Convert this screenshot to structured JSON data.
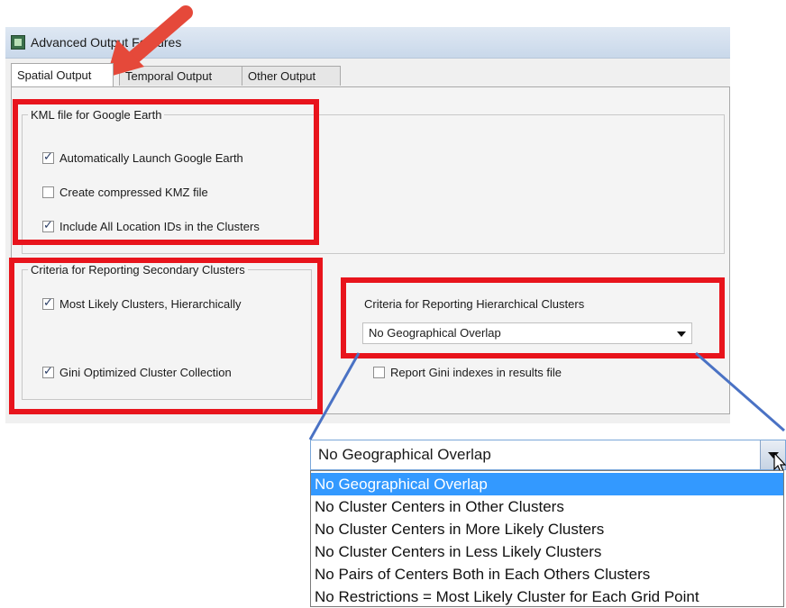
{
  "window": {
    "title": "Advanced Output Features",
    "icon": "app-icon"
  },
  "tabs": [
    "Spatial Output",
    "Temporal Output",
    "Other Output"
  ],
  "kml": {
    "legend": "KML file for Google Earth",
    "options": [
      {
        "label": "Automatically Launch Google Earth",
        "checked": true
      },
      {
        "label": "Create compressed KMZ file",
        "checked": false
      },
      {
        "label": "Include All Location IDs in the Clusters",
        "checked": true
      }
    ]
  },
  "secondary": {
    "legend": "Criteria for Reporting Secondary Clusters",
    "options": [
      {
        "label": "Most Likely Clusters, Hierarchically",
        "checked": true
      },
      {
        "label": "Gini Optimized Cluster Collection",
        "checked": true
      }
    ]
  },
  "hierarchical": {
    "label": "Criteria for Reporting Hierarchical Clusters",
    "selected": "No Geographical Overlap"
  },
  "gini_report": {
    "label": "Report Gini indexes in results file",
    "checked": false
  },
  "dropdown_zoom": {
    "selected": "No Geographical Overlap",
    "options": [
      "No Geographical Overlap",
      "No Cluster Centers in Other Clusters",
      "No Cluster Centers in More Likely Clusters",
      "No Cluster Centers in Less Likely Clusters",
      "No Pairs of Centers Both in Each Others Clusters",
      "No Restrictions = Most Likely Cluster for Each Grid Point"
    ]
  },
  "colors": {
    "highlight": "#e8141c",
    "callout_line": "#4a72c4",
    "arrow": "#e5493a",
    "selection": "#3399ff"
  }
}
